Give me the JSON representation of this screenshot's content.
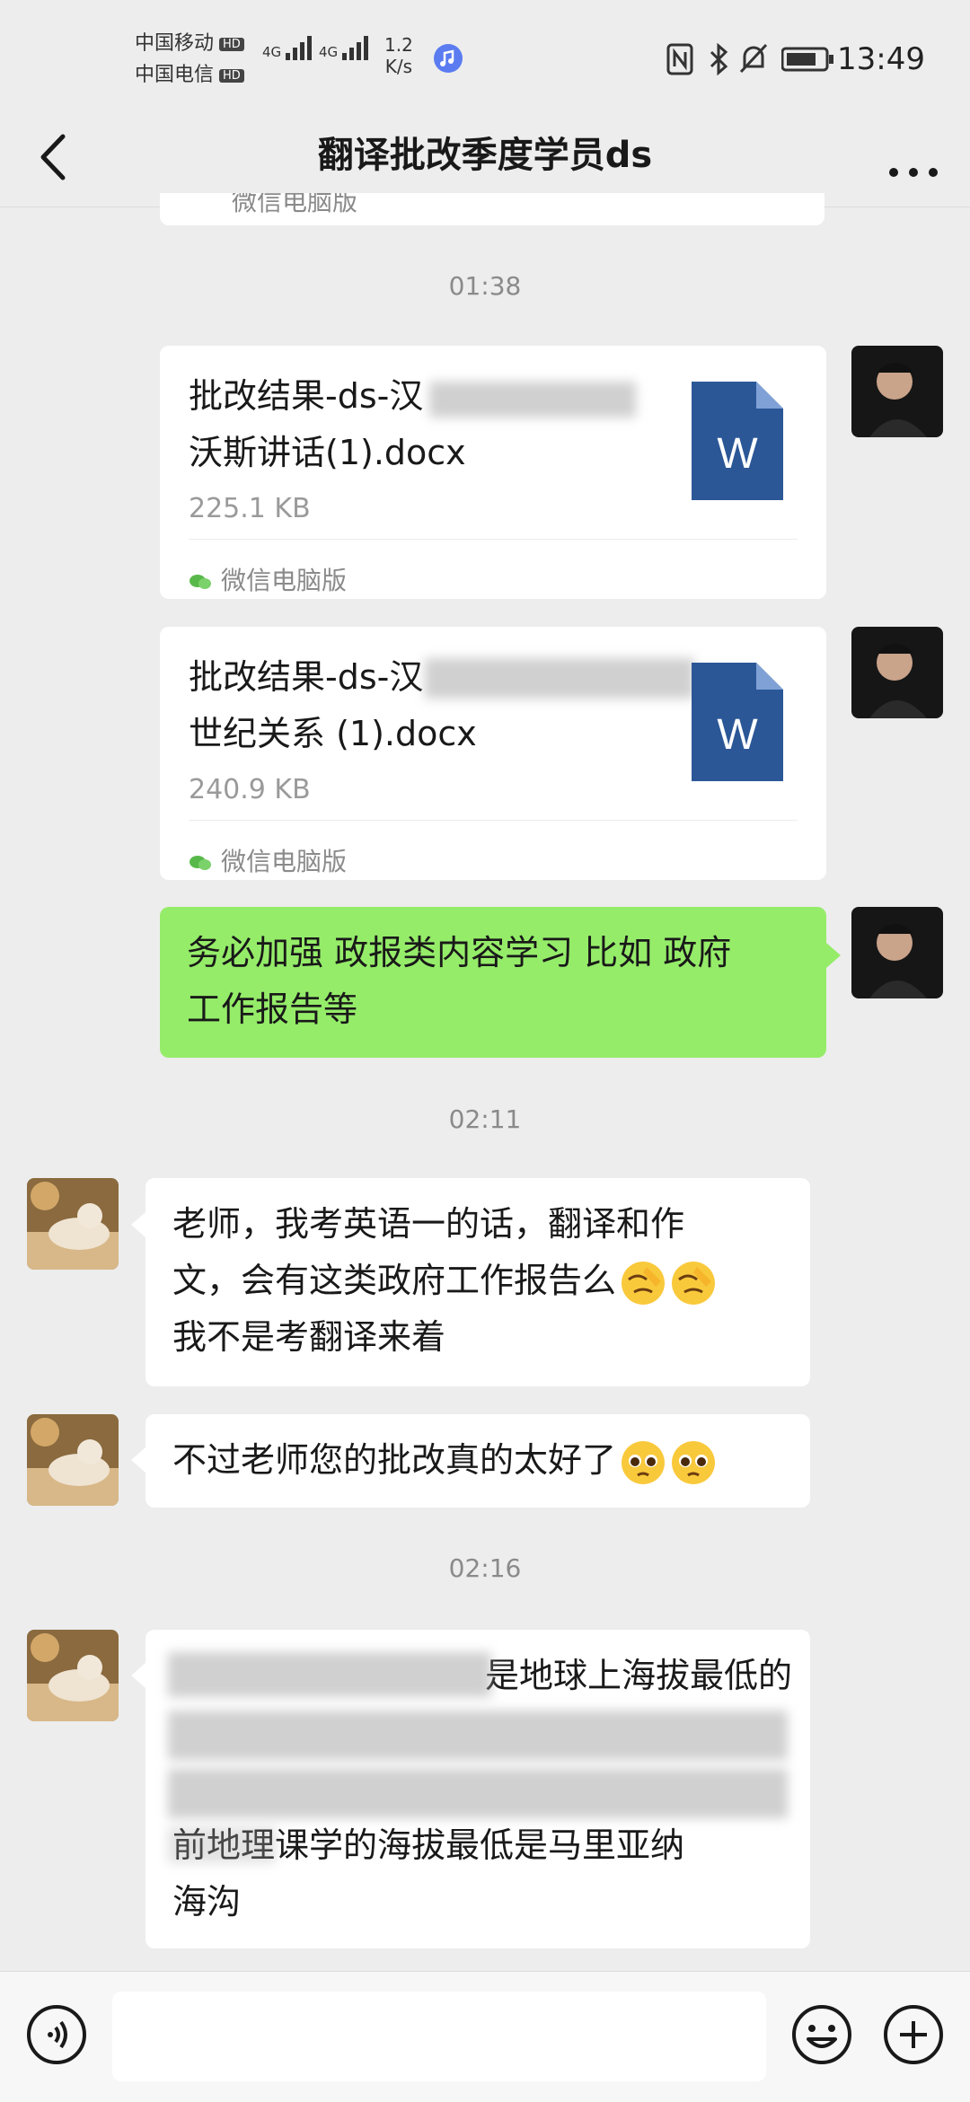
{
  "status_bar": {
    "carrier1": "中国移动",
    "carrier2": "中国电信",
    "hd": "HD",
    "net1": "4G",
    "net2": "4G",
    "speed_value": "1.2",
    "speed_unit": "K/s",
    "time": "13:49"
  },
  "header": {
    "title": "翻译批改季度学员ds",
    "back_icon": "chevron-left-icon",
    "more_icon": "more-dots-icon"
  },
  "messages": {
    "partial_top_text": "微信电脑版",
    "ts1": "01:38",
    "file1": {
      "line1": "批改结果-ds-汉",
      "line2": "沃斯讲话(1).docx",
      "size": "225.1 KB",
      "source": "微信电脑版",
      "icon_letter": "W"
    },
    "file2": {
      "line1": "批改结果-ds-汉",
      "line2": "世纪关系 (1).docx",
      "size": "240.9 KB",
      "source": "微信电脑版",
      "icon_letter": "W"
    },
    "sent_text_line1": "务必加强 政报类内容学习 比如 政府",
    "sent_text_line2": "工作报告等",
    "ts2": "02:11",
    "recv1_line1": "老师，我考英语一的话，翻译和作",
    "recv1_line2": "文，会有这类政府工作报告么",
    "recv1_line3": "我不是考翻译来着",
    "recv2": "不过老师您的批改真的太好了",
    "ts3": "02:16",
    "recv3_line1": "是地球上海拔最低的",
    "recv3_line4": "前地理课学的海拔最低是马里亚纳",
    "recv3_line5": "海沟"
  },
  "colors": {
    "background": "#ededed",
    "sent_bubble": "#95ec69",
    "received_bubble": "#ffffff",
    "word_blue": "#2b5797"
  },
  "icons": [
    "voice-icon",
    "emoji-icon",
    "plus-icon"
  ]
}
